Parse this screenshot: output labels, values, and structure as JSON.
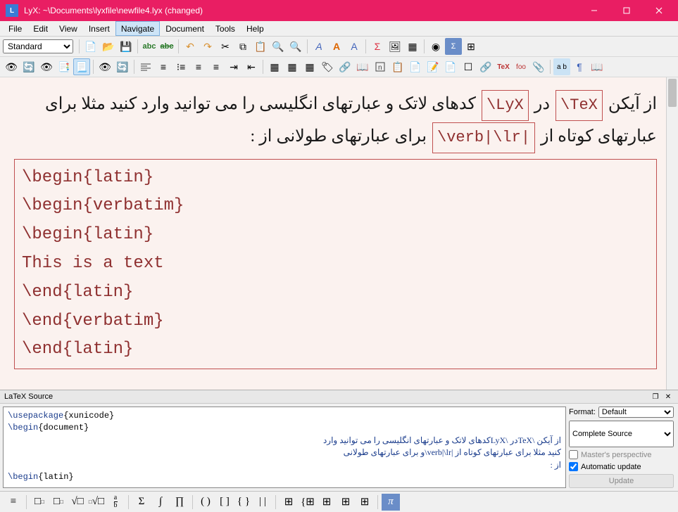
{
  "window": {
    "title": "LyX: ~\\Documents\\lyxfile\\newfile4.lyx (changed)"
  },
  "menu": {
    "items": [
      "File",
      "Edit",
      "View",
      "Insert",
      "Navigate",
      "Document",
      "Tools",
      "Help"
    ],
    "active_index": 4
  },
  "toolbar": {
    "layout_style": "Standard"
  },
  "editor": {
    "para1_pre": "از آیکن ",
    "tex1": "\\TeX",
    "para1_mid": " در ",
    "tex2": "\\LyX",
    "para1_post": " کدهای لاتک و عبارتهای انگلیسی را می توانید وارد کنید مثلا برای عبارتهای کوتاه از ",
    "tex3": "\\verb|\\lr|",
    "para1_end": " برای عبارتهای طولانی از :",
    "latex_lines": [
      "\\begin{latin}",
      "\\begin{verbatim}",
      "\\begin{latin}",
      "This is a text",
      "\\end{latin}",
      "\\end{verbatim}",
      "\\end{latin}"
    ]
  },
  "source_panel": {
    "title": "LaTeX Source",
    "line1_a": "\\usepackage",
    "line1_b": "{xunicode}",
    "line2_a": "\\begin",
    "line2_b": "{document}",
    "rtl1": "از آیکن \\TeXدر \\LyXکدهای لاتک و عبارتهای انگلیسی را می توانید وارد",
    "rtl2": "کنید مثلا برای عبارتهای کوتاه از |verb|\\lr\\و برای عبارتهای طولانی",
    "rtl3": "از :",
    "line3_a": "\\begin",
    "line3_b": "{latin}",
    "format_label": "Format:",
    "format_value": "Default",
    "scope_value": "Complete Source",
    "masters_label": "Master's perspective",
    "auto_label": "Automatic update",
    "auto_checked": true,
    "update_label": "Update"
  },
  "chart_data": null
}
